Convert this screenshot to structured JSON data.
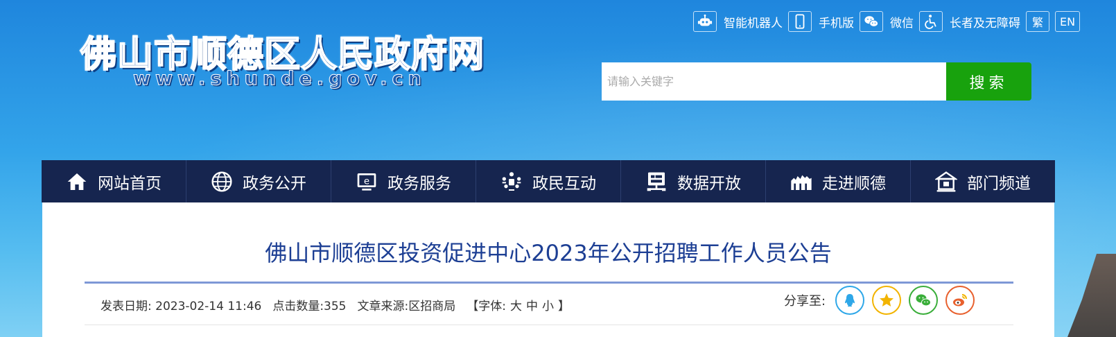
{
  "site": {
    "title": "佛山市顺德区人民政府网",
    "url": "www.shunde.gov.cn"
  },
  "toolbar": {
    "items": [
      {
        "label": "智能机器人",
        "icon": "robot-icon"
      },
      {
        "label": "手机版",
        "icon": "mobile-icon"
      },
      {
        "label": "微信",
        "icon": "wechat-icon"
      },
      {
        "label": "长者及无障碍",
        "icon": "accessibility-icon"
      }
    ],
    "traditional": "繁",
    "english": "EN"
  },
  "search": {
    "placeholder": "请输入关键字",
    "button": "搜索"
  },
  "nav": {
    "items": [
      {
        "label": "网站首页",
        "icon": "home-icon"
      },
      {
        "label": "政务公开",
        "icon": "globe-icon"
      },
      {
        "label": "政务服务",
        "icon": "service-icon"
      },
      {
        "label": "政民互动",
        "icon": "interaction-icon"
      },
      {
        "label": "数据开放",
        "icon": "data-icon"
      },
      {
        "label": "走进顺德",
        "icon": "building-icon"
      },
      {
        "label": "部门频道",
        "icon": "department-icon"
      }
    ]
  },
  "article": {
    "title": "佛山市顺德区投资促进中心2023年公开招聘工作人员公告",
    "date": "发表日期: 2023-02-14 11:46",
    "clicks": "点击数量:355",
    "source": "文章来源:区招商局",
    "font_prefix": "【字体:",
    "font_large": "大",
    "font_medium": "中",
    "font_small": "小",
    "font_suffix": "】"
  },
  "share": {
    "label": "分享至:",
    "targets": [
      {
        "name": "QQ",
        "icon": "qq-icon",
        "color": "#2ea7e8"
      },
      {
        "name": "QQ空间",
        "icon": "qzone-icon",
        "color": "#f2b400"
      },
      {
        "name": "微信",
        "icon": "wechat-icon",
        "color": "#3aae3a"
      },
      {
        "name": "微博",
        "icon": "weibo-icon",
        "color": "#e8602d"
      }
    ]
  }
}
